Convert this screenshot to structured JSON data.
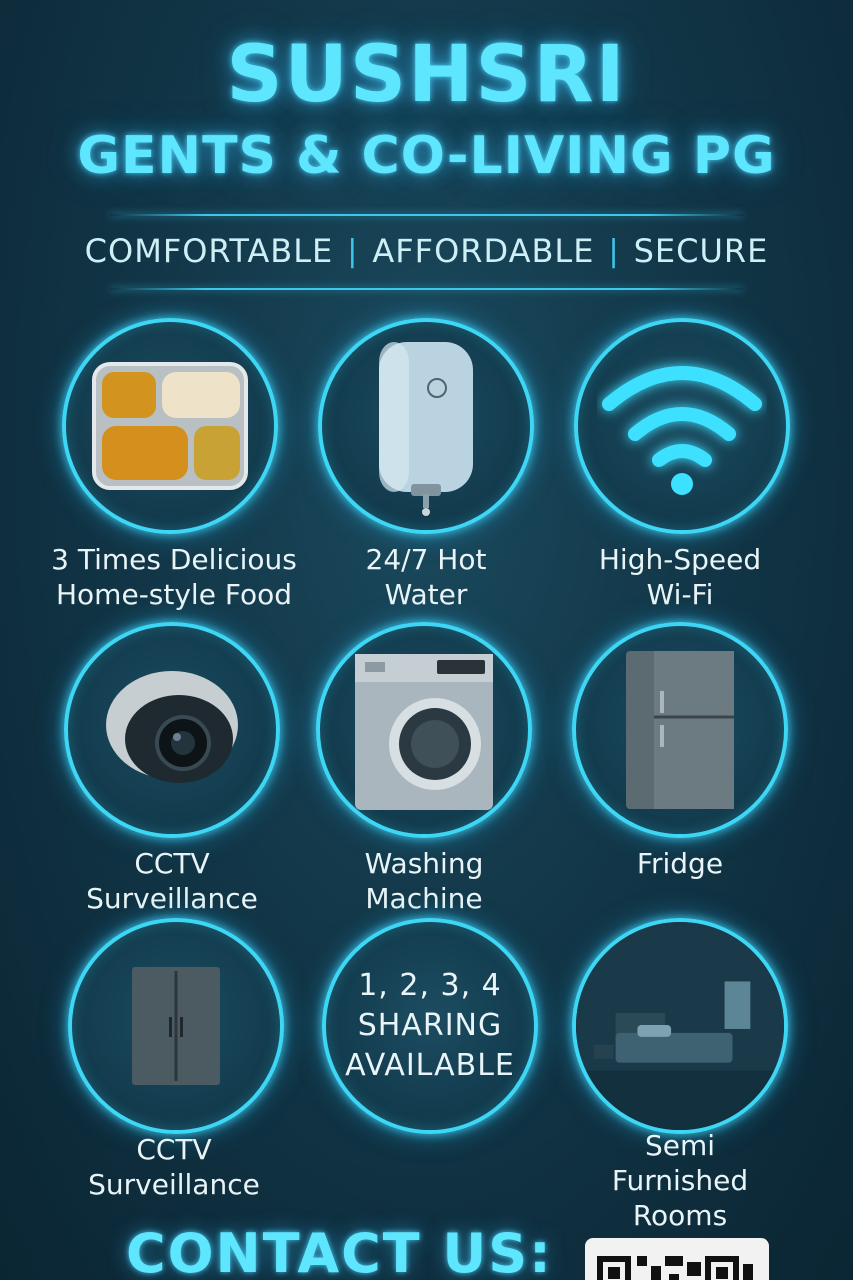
{
  "header": {
    "title": "SUSHSRI",
    "subtitle": "GENTS & CO-LIVING PG",
    "tagline": [
      "COMFORTABLE",
      "AFFORDABLE",
      "SECURE"
    ],
    "tagline_separator": "|"
  },
  "amenities": [
    {
      "icon": "food-thali-icon",
      "label_line1": "3 Times Delicious",
      "label_line2": "Home-style Food"
    },
    {
      "icon": "water-heater-icon",
      "label_line1": "24/7 Hot",
      "label_line2": "Water"
    },
    {
      "icon": "wifi-icon",
      "label_line1": "High-Speed",
      "label_line2": "Wi-Fi"
    },
    {
      "icon": "cctv-camera-icon",
      "label_line1": "CCTV",
      "label_line2": "Surveillance"
    },
    {
      "icon": "washing-machine-icon",
      "label_line1": "Washing",
      "label_line2": "Machine"
    },
    {
      "icon": "fridge-icon",
      "label_line1": "Fridge"
    },
    {
      "icon": "wardrobe-icon",
      "label_line1": "CCTV",
      "label_line2": "Surveillance"
    },
    {
      "sharing_line1": "1, 2, 3, 4",
      "sharing_line2": "SHARING",
      "sharing_line3": "AVAILABLE"
    },
    {
      "icon": "bedroom-icon",
      "label_line1": "Semi",
      "label_line2": "Furnished",
      "label_line3": "Rooms"
    }
  ],
  "contact": {
    "heading": "CONTACT US:"
  },
  "colors": {
    "accent": "#3ed6f5",
    "title": "#5fe6ff",
    "background": "#123748"
  }
}
